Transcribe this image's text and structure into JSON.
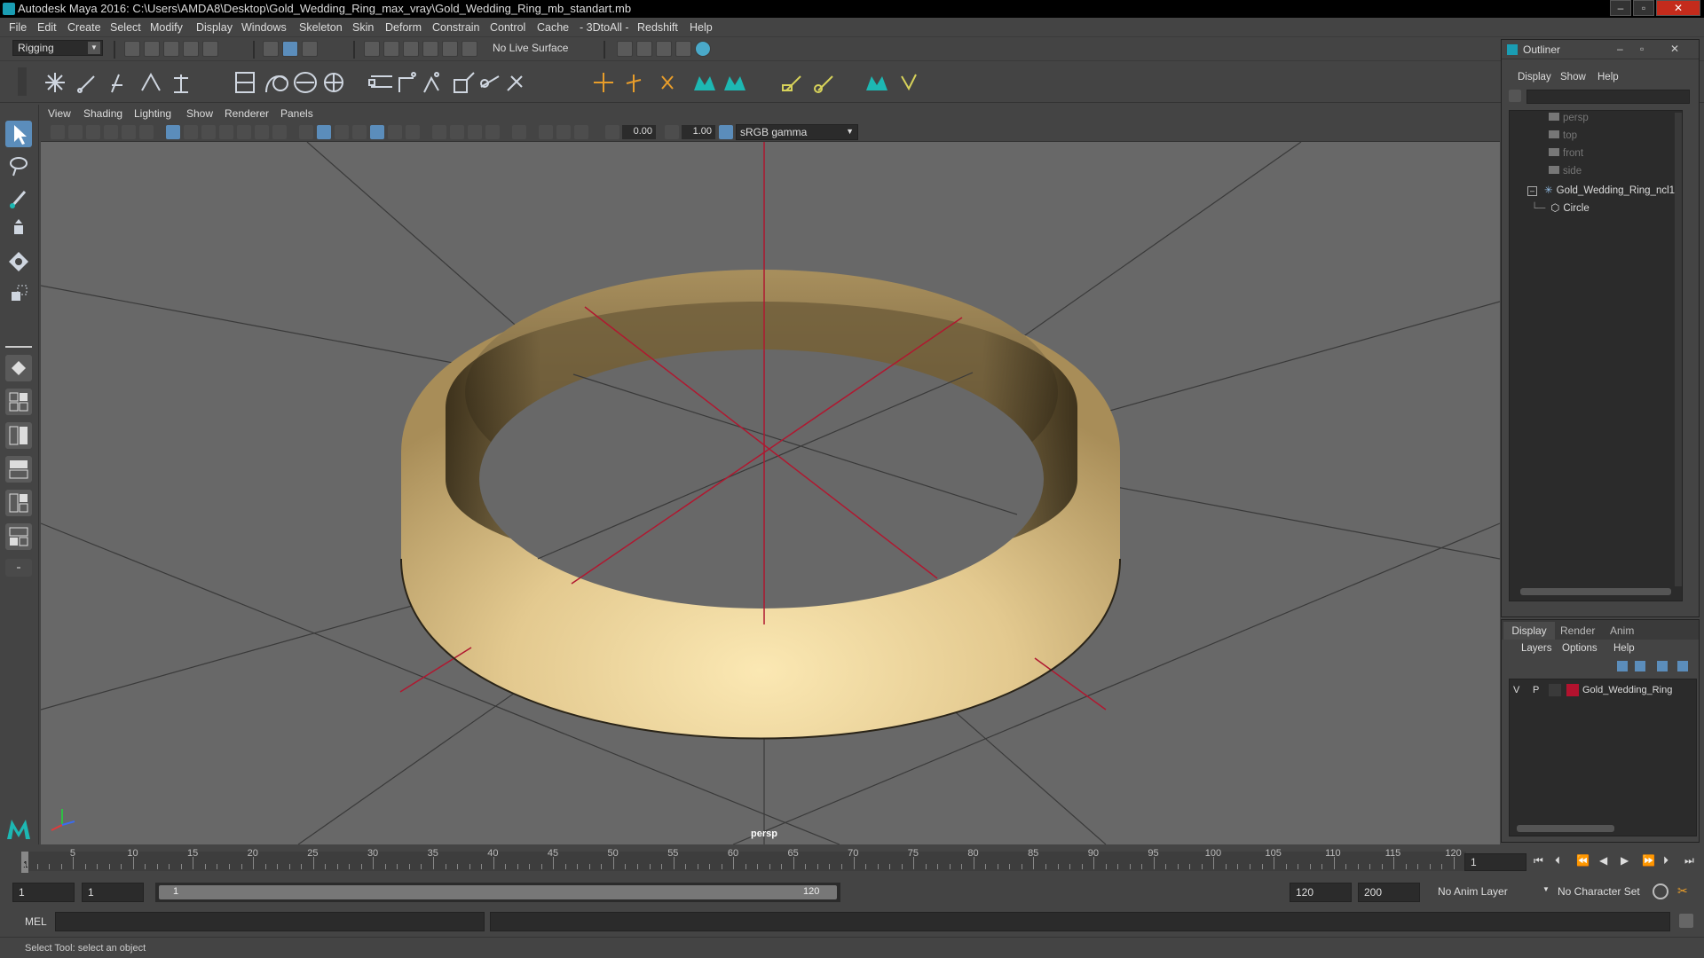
{
  "app": {
    "title": "Autodesk Maya 2016: C:\\Users\\AMDA8\\Desktop\\Gold_Wedding_Ring_max_vray\\Gold_Wedding_Ring_mb_standart.mb"
  },
  "menubar": [
    "File",
    "Edit",
    "Create",
    "Select",
    "Modify",
    "Display",
    "Windows",
    "Skeleton",
    "Skin",
    "Deform",
    "Constrain",
    "Control",
    "Cache",
    "- 3DtoAll -",
    "Redshift",
    "Help"
  ],
  "status": {
    "menu_set": "Rigging",
    "live_surface": "No Live Surface"
  },
  "viewport": {
    "menu": [
      "View",
      "Shading",
      "Lighting",
      "Show",
      "Renderer",
      "Panels"
    ],
    "exposure": "0.00",
    "gamma": "1.00",
    "color_space": "sRGB gamma",
    "camera_label": "persp"
  },
  "outliner": {
    "title": "Outliner",
    "menu": [
      "Display",
      "Show",
      "Help"
    ],
    "items": [
      {
        "label": "persp",
        "dim": true
      },
      {
        "label": "top",
        "dim": true
      },
      {
        "label": "front",
        "dim": true
      },
      {
        "label": "side",
        "dim": true
      },
      {
        "label": "Gold_Wedding_Ring_ncl1",
        "dim": false
      },
      {
        "label": "Circle",
        "dim": false
      }
    ]
  },
  "layer_editor": {
    "tabs": [
      "Display",
      "Render",
      "Anim"
    ],
    "menu": [
      "Layers",
      "Options",
      "Help"
    ],
    "layer": {
      "v": "V",
      "p": "P",
      "name": "Gold_Wedding_Ring",
      "color": "#b3122e"
    }
  },
  "timeslider": {
    "ticks": [
      "5",
      "10",
      "15",
      "20",
      "25",
      "30",
      "35",
      "40",
      "45",
      "50",
      "55",
      "60",
      "65",
      "70",
      "75",
      "80",
      "85",
      "90",
      "95",
      "100",
      "105",
      "110",
      "115",
      "120"
    ],
    "current_frame_marker": "1",
    "current_frame_field": "1"
  },
  "range": {
    "start_field": "1",
    "playback_start": "1",
    "slider_start": "1",
    "slider_end": "120",
    "playback_end": "120",
    "end_field": "200",
    "anim_layer": "No Anim Layer",
    "character_set": "No Character Set"
  },
  "command": {
    "lang": "MEL"
  },
  "help_line": "Select Tool: select an object",
  "colors": {
    "ring": "#d8bf86",
    "axis": "#b01830",
    "accent": "#5b8dbb"
  }
}
